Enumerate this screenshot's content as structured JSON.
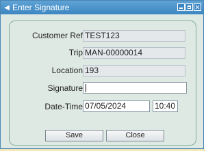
{
  "window": {
    "title": "Enter Signature"
  },
  "form": {
    "customer_ref": {
      "label": "Customer Ref",
      "value": "TEST123"
    },
    "trip": {
      "label": "Trip",
      "value": "MAN-00000014"
    },
    "location": {
      "label": "Location",
      "value": "193"
    },
    "signature": {
      "label": "Signature",
      "value": ""
    },
    "datetime": {
      "label": "Date-Time",
      "date": "07/05/2024",
      "time": "10:40"
    }
  },
  "buttons": {
    "save": "Save",
    "close": "Close"
  }
}
